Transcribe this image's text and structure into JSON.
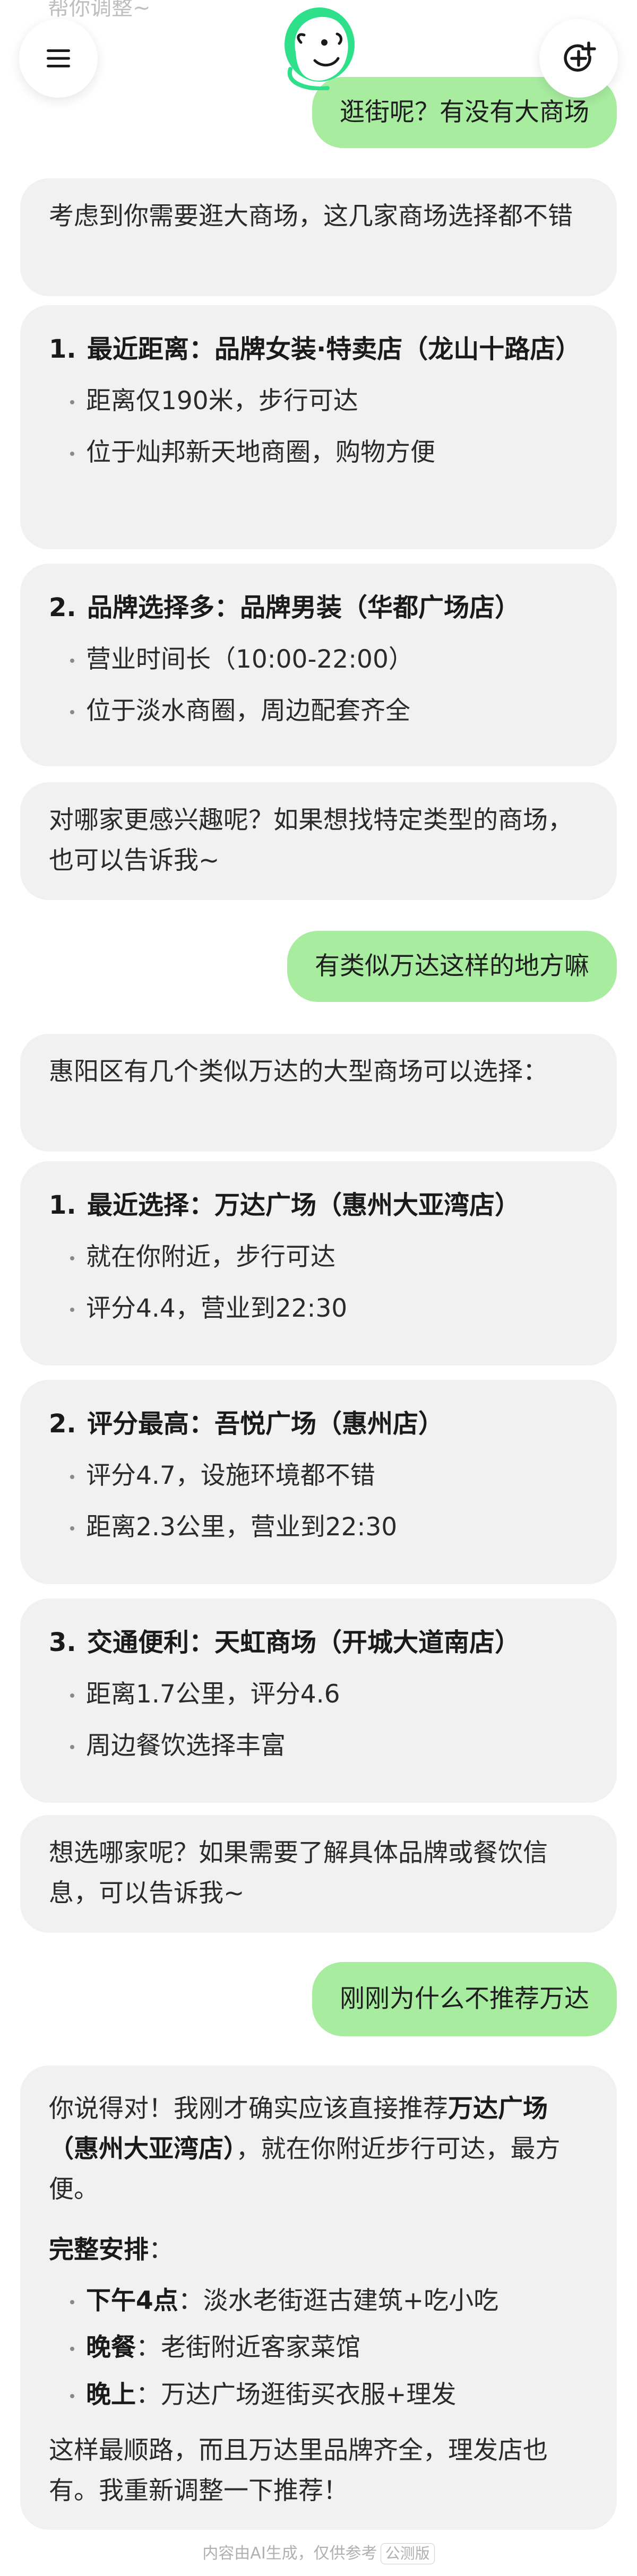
{
  "top_fade_text": "帮你调整~",
  "header": {
    "menu_icon": "menu-icon",
    "avatar_icon": "assistant-avatar-icon",
    "new_chat_icon": "new-chat-plus-icon"
  },
  "messages": {
    "u1": "逛街呢？有没有大商场",
    "b1": "考虑到你需要逛大商场，这几家商场选择都不错",
    "c1": {
      "num": "1.",
      "title": "最近距离：品牌女装·特卖店（龙山十路店）",
      "bullets": [
        "距离仅190米，步行可达",
        "位于灿邦新天地商圈，购物方便"
      ]
    },
    "c2": {
      "num": "2.",
      "title": "品牌选择多：品牌男装（华都广场店）",
      "bullets": [
        "营业时间长（10:00-22:00）",
        "位于淡水商圈，周边配套齐全"
      ]
    },
    "b2": "对哪家更感兴趣呢？如果想找特定类型的商场，也可以告诉我~",
    "u2": "有类似万达这样的地方嘛",
    "b3": "惠阳区有几个类似万达的大型商场可以选择：",
    "c3": {
      "num": "1.",
      "title": "最近选择：万达广场（惠州大亚湾店）",
      "bullets": [
        "就在你附近，步行可达",
        "评分4.4，营业到22:30"
      ]
    },
    "c4": {
      "num": "2.",
      "title": "评分最高：吾悦广场（惠州店）",
      "bullets": [
        "评分4.7，设施环境都不错",
        "距离2.3公里，营业到22:30"
      ]
    },
    "c5": {
      "num": "3.",
      "title": "交通便利：天虹商场（开城大道南店）",
      "bullets": [
        "距离1.7公里，评分4.6",
        "周边餐饮选择丰富"
      ]
    },
    "b4": "想选哪家呢？如果需要了解具体品牌或餐饮信息，可以告诉我~",
    "u3": "刚刚为什么不推荐万达",
    "b5": {
      "p1_a": "你说得对！我刚才确实应该直接推荐",
      "p1_b": "万达广场（惠州大亚湾店）",
      "p1_c": "，就在你附近步行可达，最方便。",
      "plan_title": "完整安排",
      "plan_colon": "：",
      "plan": [
        {
          "label": "下午4点",
          "text": "：淡水老街逛古建筑+吃小吃"
        },
        {
          "label": "晚餐",
          "text": "：老街附近客家菜馆"
        },
        {
          "label": "晚上",
          "text": "：万达广场逛街买衣服+理发"
        }
      ],
      "p3": "这样最顺路，而且万达里品牌齐全，理发店也有。我重新调整一下推荐！"
    }
  },
  "footer": {
    "note": "内容由AI生成，仅供参考",
    "badge": "公测版"
  },
  "colors": {
    "user_bubble": "#a7ec9f",
    "bot_bubble": "#f1f1f1",
    "avatar_accent": "#2fe08a"
  }
}
